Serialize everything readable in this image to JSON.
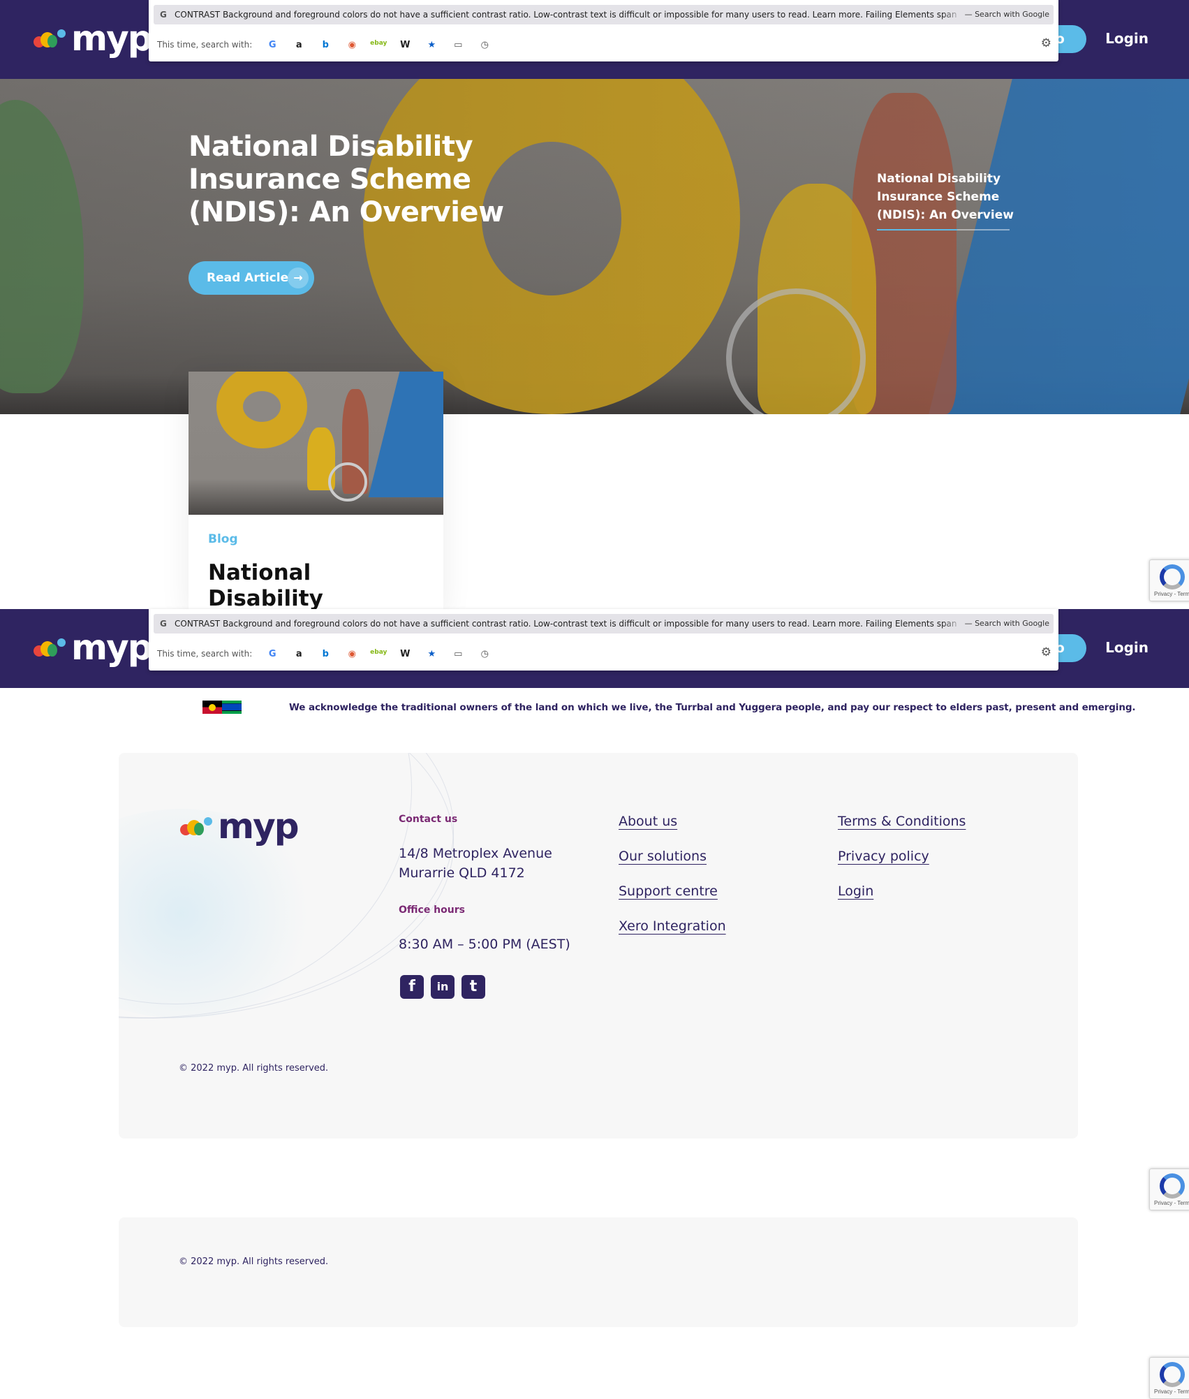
{
  "brand": {
    "name": "myp",
    "colors": {
      "header": "#2f2461",
      "accent": "#5bbbe8",
      "heading_purple": "#7b2a74"
    },
    "logo_dot_colors": [
      "#e8453c",
      "#f4b400",
      "#2f9e5a",
      "#5bbbe8"
    ]
  },
  "header": {
    "demo_label": "mo",
    "login_label": "Login"
  },
  "search_overlay": {
    "google_glyph": "G",
    "query_text": "CONTRAST Background and foreground colors do not have a sufficient contrast ratio. Low-contrast text is difficult or impossible for many users to read. Learn more. Failing Elements span a.nectar-l",
    "search_with_google": "— Search with Google",
    "this_time_label": "This time, search with:",
    "engines": [
      {
        "name": "google-icon",
        "glyph": "G",
        "color": "#4285f4"
      },
      {
        "name": "amazon-icon",
        "glyph": "a",
        "color": "#222222"
      },
      {
        "name": "bing-icon",
        "glyph": "b",
        "color": "#0078d4"
      },
      {
        "name": "duckduckgo-icon",
        "glyph": "◉",
        "color": "#de5833"
      },
      {
        "name": "ebay-icon",
        "glyph": "ebay",
        "color": "#86b817"
      },
      {
        "name": "wikipedia-icon",
        "glyph": "W",
        "color": "#222222"
      },
      {
        "name": "bookmarks-icon",
        "glyph": "★",
        "color": "#0a5ec8"
      },
      {
        "name": "tabs-icon",
        "glyph": "▭",
        "color": "#555555"
      },
      {
        "name": "history-icon",
        "glyph": "◷",
        "color": "#555555"
      }
    ],
    "settings_icon": "⚙"
  },
  "hero": {
    "title": "National Disability Insurance Scheme (NDIS): An Overview",
    "button_label": "Read Article",
    "button_arrow": "→",
    "side_link": "National Disability Insurance Scheme (NDIS): An Overview"
  },
  "card": {
    "tag": "Blog",
    "title": "National Disability Insurance Scheme"
  },
  "recaptcha": {
    "text": "Privacy - Terms"
  },
  "acknowledgement": {
    "text": "We acknowledge the traditional owners of the land on which we live, the Turrbal and Yuggera people, and pay our respect to elders past, present and emerging."
  },
  "footer": {
    "contact_heading": "Contact us",
    "address_line1": "14/8 Metroplex Avenue",
    "address_line2": "Murarrie QLD 4172",
    "hours_heading": "Office hours",
    "hours": "8:30 AM – 5:00 PM (AEST)",
    "links_col1": [
      "About us",
      "Our solutions",
      "Support centre",
      "Xero Integration"
    ],
    "links_col2": [
      "Terms & Conditions",
      "Privacy policy",
      "Login"
    ],
    "social": [
      {
        "name": "facebook-icon",
        "glyph": "f"
      },
      {
        "name": "linkedin-icon",
        "glyph": "in"
      },
      {
        "name": "twitter-icon",
        "glyph": "t"
      }
    ],
    "copyright": "© 2022 myp.  All rights reserved."
  }
}
